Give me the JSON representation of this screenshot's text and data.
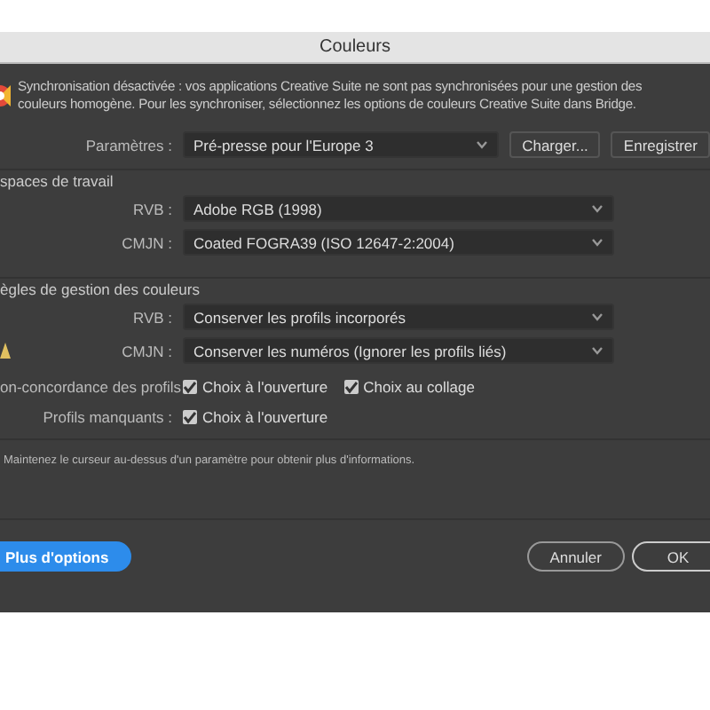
{
  "window": {
    "title": "Couleurs"
  },
  "sync_message": [
    "Synchronisation désactivée : vos applications Creative Suite ne sont pas synchronisées pour une gestion des",
    "couleurs homogène. Pour les synchroniser, sélectionnez les options de couleurs Creative Suite dans Bridge."
  ],
  "settings": {
    "label": "Paramètres :",
    "value": "Pré-presse pour l'Europe 3",
    "buttons": [
      "Charger...",
      "Enregistrer"
    ]
  },
  "sections": [
    {
      "title": "spaces de travail",
      "rows": [
        {
          "label": "RVB :",
          "value": "Adobe RGB (1998)"
        },
        {
          "label": "CMJN :",
          "value": "Coated FOGRA39 (ISO 12647-2:2004)"
        }
      ]
    },
    {
      "title": "ègles de gestion des couleurs",
      "rows": [
        {
          "label": "RVB :",
          "value": "Conserver les profils incorporés"
        },
        {
          "label": "CMJN :",
          "value": "Conserver les numéros (Ignorer les profils liés)",
          "warning": true
        }
      ]
    }
  ],
  "checkbox_rows": [
    {
      "label": "on-concordance des profils",
      "options": [
        {
          "label": "Choix à l'ouverture",
          "checked": true
        },
        {
          "label": "Choix au collage",
          "checked": true
        }
      ]
    },
    {
      "label": "Profils manquants :",
      "options": [
        {
          "label": "Choix à l'ouverture",
          "checked": true
        }
      ]
    }
  ],
  "help_text": "Maintenez le curseur au-dessus d'un paramètre pour obtenir plus d'informations.",
  "buttons": [
    {
      "label": "Plus d'options",
      "kind": "primary"
    },
    {
      "label": "Annuler",
      "kind": "normal"
    },
    {
      "label": "OK",
      "kind": "default"
    }
  ]
}
